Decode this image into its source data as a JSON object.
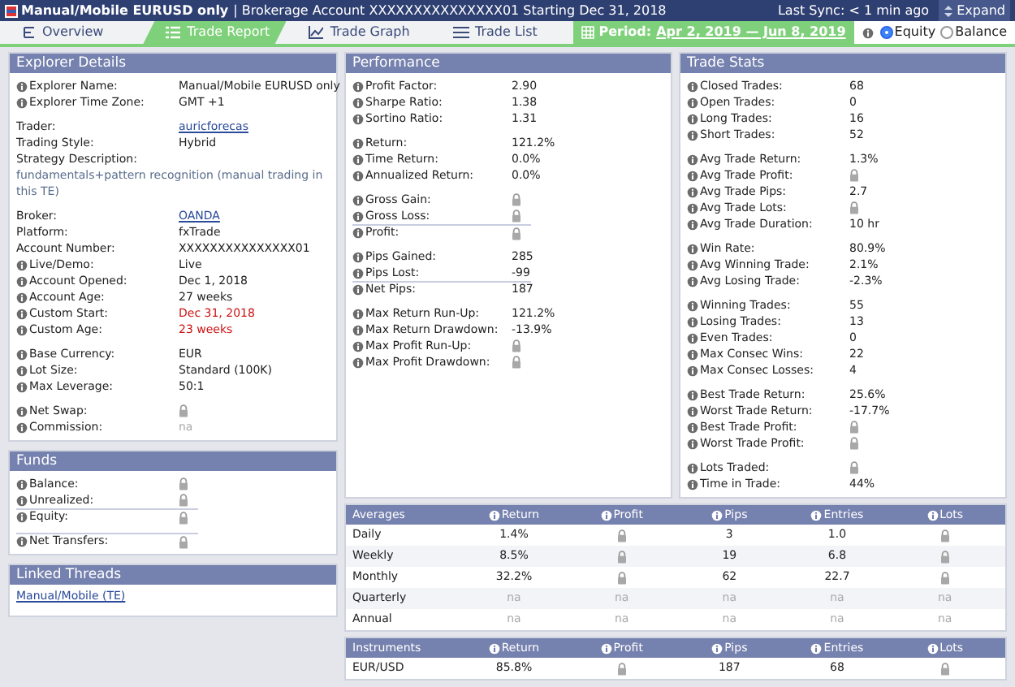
{
  "header": {
    "title": "Manual/Mobile EURUSD only",
    "subtitle": "| Brokerage Account XXXXXXXXXXXXXXX01 Starting Dec 31, 2018",
    "sync": "Last Sync: < 1 min ago",
    "expand": "Expand"
  },
  "tabs": [
    {
      "label": "Overview",
      "selected": false
    },
    {
      "label": "Trade Report",
      "selected": true
    },
    {
      "label": "Trade Graph",
      "selected": false
    },
    {
      "label": "Trade List",
      "selected": false
    }
  ],
  "period": {
    "label": "Period:",
    "value": "Apr 2, 2019 — Jun 8, 2019"
  },
  "modes": [
    {
      "label": "Equity",
      "selected": true
    },
    {
      "label": "Balance",
      "selected": false
    }
  ],
  "explorer": {
    "title": "Explorer Details",
    "groups": [
      [
        {
          "label": "Explorer Name:",
          "info": true,
          "kind": "text",
          "value": "Manual/Mobile EURUSD only"
        },
        {
          "label": "Explorer Time Zone:",
          "info": true,
          "kind": "text",
          "value": "GMT +1"
        }
      ],
      [
        {
          "label": "Trader:",
          "info": false,
          "kind": "link",
          "value": "auricforecas"
        },
        {
          "label": "Trading Style:",
          "info": false,
          "kind": "text",
          "value": "Hybrid"
        },
        {
          "label": "Strategy Description:",
          "info": false,
          "kind": "heading"
        },
        {
          "kind": "description",
          "value": "fundamentals+pattern recognition (manual trading in this TE)"
        }
      ],
      [
        {
          "label": "Broker:",
          "info": false,
          "kind": "link",
          "value": "OANDA"
        },
        {
          "label": "Platform:",
          "info": false,
          "kind": "text",
          "value": "fxTrade"
        },
        {
          "label": "Account Number:",
          "info": false,
          "kind": "text",
          "value": "XXXXXXXXXXXXXXX01"
        },
        {
          "label": "Live/Demo:",
          "info": true,
          "kind": "text",
          "value": "Live"
        },
        {
          "label": "Account Opened:",
          "info": true,
          "kind": "text",
          "value": "Dec 1, 2018"
        },
        {
          "label": "Account Age:",
          "info": true,
          "kind": "text",
          "value": "27 weeks"
        },
        {
          "label": "Custom Start:",
          "info": true,
          "kind": "alert",
          "value": "Dec 31, 2018"
        },
        {
          "label": "Custom Age:",
          "info": true,
          "kind": "alert",
          "value": "23 weeks"
        }
      ],
      [
        {
          "label": "Base Currency:",
          "info": true,
          "kind": "text",
          "value": "EUR"
        },
        {
          "label": "Lot Size:",
          "info": true,
          "kind": "text",
          "value": "Standard (100K)"
        },
        {
          "label": "Max Leverage:",
          "info": true,
          "kind": "text",
          "value": "50:1"
        }
      ],
      [
        {
          "label": "Net Swap:",
          "info": true,
          "kind": "lock"
        },
        {
          "label": "Commission:",
          "info": true,
          "kind": "na",
          "value": "na"
        }
      ]
    ]
  },
  "funds": {
    "title": "Funds",
    "groups": [
      [
        {
          "label": "Balance:",
          "info": true,
          "kind": "lock"
        },
        {
          "label": "Unrealized:",
          "info": true,
          "kind": "lock"
        },
        {
          "label": "Equity:",
          "info": true,
          "kind": "lock",
          "rule_above": true
        }
      ],
      [
        {
          "label": "Net Transfers:",
          "info": true,
          "kind": "lock",
          "rule_above": true
        }
      ]
    ]
  },
  "linked_threads": {
    "title": "Linked Threads",
    "links": [
      "Manual/Mobile (TE)"
    ]
  },
  "performance": {
    "title": "Performance",
    "groups": [
      [
        {
          "label": "Profit Factor:",
          "info": true,
          "kind": "text",
          "value": "2.90"
        },
        {
          "label": "Sharpe Ratio:",
          "info": true,
          "kind": "text",
          "value": "1.38"
        },
        {
          "label": "Sortino Ratio:",
          "info": true,
          "kind": "text",
          "value": "1.31"
        }
      ],
      [
        {
          "label": "Return:",
          "info": true,
          "kind": "text",
          "value": "121.2%"
        },
        {
          "label": "Time Return:",
          "info": true,
          "kind": "text",
          "value": "0.0%"
        },
        {
          "label": "Annualized Return:",
          "info": true,
          "kind": "text",
          "value": "0.0%"
        }
      ],
      [
        {
          "label": "Gross Gain:",
          "info": true,
          "kind": "lock"
        },
        {
          "label": "Gross Loss:",
          "info": true,
          "kind": "lock"
        },
        {
          "label": "Profit:",
          "info": true,
          "kind": "lock",
          "rule_above": true
        }
      ],
      [
        {
          "label": "Pips Gained:",
          "info": true,
          "kind": "text",
          "value": "285"
        },
        {
          "label": "Pips Lost:",
          "info": true,
          "kind": "text",
          "value": "-99"
        },
        {
          "label": "Net Pips:",
          "info": true,
          "kind": "text",
          "value": "187",
          "rule_above": true
        }
      ],
      [
        {
          "label": "Max Return Run-Up:",
          "info": true,
          "kind": "text",
          "value": "121.2%"
        },
        {
          "label": "Max Return Drawdown:",
          "info": true,
          "kind": "text",
          "value": "-13.9%"
        },
        {
          "label": "Max Profit Run-Up:",
          "info": true,
          "kind": "lock"
        },
        {
          "label": "Max Profit Drawdown:",
          "info": true,
          "kind": "lock"
        }
      ]
    ]
  },
  "trade_stats": {
    "title": "Trade Stats",
    "groups": [
      [
        {
          "label": "Closed Trades:",
          "info": true,
          "kind": "text",
          "value": "68"
        },
        {
          "label": "Open Trades:",
          "info": true,
          "kind": "text",
          "value": "0"
        },
        {
          "label": "Long Trades:",
          "info": true,
          "kind": "text",
          "value": "16"
        },
        {
          "label": "Short Trades:",
          "info": true,
          "kind": "text",
          "value": "52"
        }
      ],
      [
        {
          "label": "Avg Trade Return:",
          "info": true,
          "kind": "text",
          "value": "1.3%"
        },
        {
          "label": "Avg Trade Profit:",
          "info": true,
          "kind": "lock"
        },
        {
          "label": "Avg Trade Pips:",
          "info": true,
          "kind": "text",
          "value": "2.7"
        },
        {
          "label": "Avg Trade Lots:",
          "info": true,
          "kind": "lock"
        },
        {
          "label": "Avg Trade Duration:",
          "info": true,
          "kind": "text",
          "value": "10 hr"
        }
      ],
      [
        {
          "label": "Win Rate:",
          "info": true,
          "kind": "text",
          "value": "80.9%"
        },
        {
          "label": "Avg Winning Trade:",
          "info": true,
          "kind": "text",
          "value": "2.1%"
        },
        {
          "label": "Avg Losing Trade:",
          "info": true,
          "kind": "text",
          "value": "-2.3%"
        }
      ],
      [
        {
          "label": "Winning Trades:",
          "info": true,
          "kind": "text",
          "value": "55"
        },
        {
          "label": "Losing Trades:",
          "info": true,
          "kind": "text",
          "value": "13"
        },
        {
          "label": "Even Trades:",
          "info": true,
          "kind": "text",
          "value": "0"
        },
        {
          "label": "Max Consec Wins:",
          "info": true,
          "kind": "text",
          "value": "22"
        },
        {
          "label": "Max Consec Losses:",
          "info": true,
          "kind": "text",
          "value": "4"
        }
      ],
      [
        {
          "label": "Best Trade Return:",
          "info": true,
          "kind": "text",
          "value": "25.6%"
        },
        {
          "label": "Worst Trade Return:",
          "info": true,
          "kind": "text",
          "value": "-17.7%"
        },
        {
          "label": "Best Trade Profit:",
          "info": true,
          "kind": "lock"
        },
        {
          "label": "Worst Trade Profit:",
          "info": true,
          "kind": "lock"
        }
      ],
      [
        {
          "label": "Lots Traded:",
          "info": true,
          "kind": "lock"
        },
        {
          "label": "Time in Trade:",
          "info": true,
          "kind": "text",
          "value": "44%"
        }
      ]
    ]
  },
  "tables": [
    {
      "title": "Averages",
      "columns": [
        "Return",
        "Profit",
        "Pips",
        "Entries",
        "Lots"
      ],
      "rows": [
        {
          "label": "Daily",
          "cells": [
            {
              "kind": "text",
              "value": "1.4%"
            },
            {
              "kind": "lock"
            },
            {
              "kind": "text",
              "value": "3"
            },
            {
              "kind": "text",
              "value": "1.0"
            },
            {
              "kind": "lock"
            }
          ]
        },
        {
          "label": "Weekly",
          "cells": [
            {
              "kind": "text",
              "value": "8.5%"
            },
            {
              "kind": "lock"
            },
            {
              "kind": "text",
              "value": "19"
            },
            {
              "kind": "text",
              "value": "6.8"
            },
            {
              "kind": "lock"
            }
          ]
        },
        {
          "label": "Monthly",
          "cells": [
            {
              "kind": "text",
              "value": "32.2%"
            },
            {
              "kind": "lock"
            },
            {
              "kind": "text",
              "value": "62"
            },
            {
              "kind": "text",
              "value": "22.7"
            },
            {
              "kind": "lock"
            }
          ]
        },
        {
          "label": "Quarterly",
          "cells": [
            {
              "kind": "na",
              "value": "na"
            },
            {
              "kind": "na",
              "value": "na"
            },
            {
              "kind": "na",
              "value": "na"
            },
            {
              "kind": "na",
              "value": "na"
            },
            {
              "kind": "na",
              "value": "na"
            }
          ]
        },
        {
          "label": "Annual",
          "cells": [
            {
              "kind": "na",
              "value": "na"
            },
            {
              "kind": "na",
              "value": "na"
            },
            {
              "kind": "na",
              "value": "na"
            },
            {
              "kind": "na",
              "value": "na"
            },
            {
              "kind": "na",
              "value": "na"
            }
          ]
        }
      ]
    },
    {
      "title": "Instruments",
      "columns": [
        "Return",
        "Profit",
        "Pips",
        "Entries",
        "Lots"
      ],
      "rows": [
        {
          "label": "EUR/USD",
          "cells": [
            {
              "kind": "text",
              "value": "85.8%"
            },
            {
              "kind": "lock"
            },
            {
              "kind": "text",
              "value": "187"
            },
            {
              "kind": "text",
              "value": "68"
            },
            {
              "kind": "lock"
            }
          ]
        }
      ]
    }
  ]
}
